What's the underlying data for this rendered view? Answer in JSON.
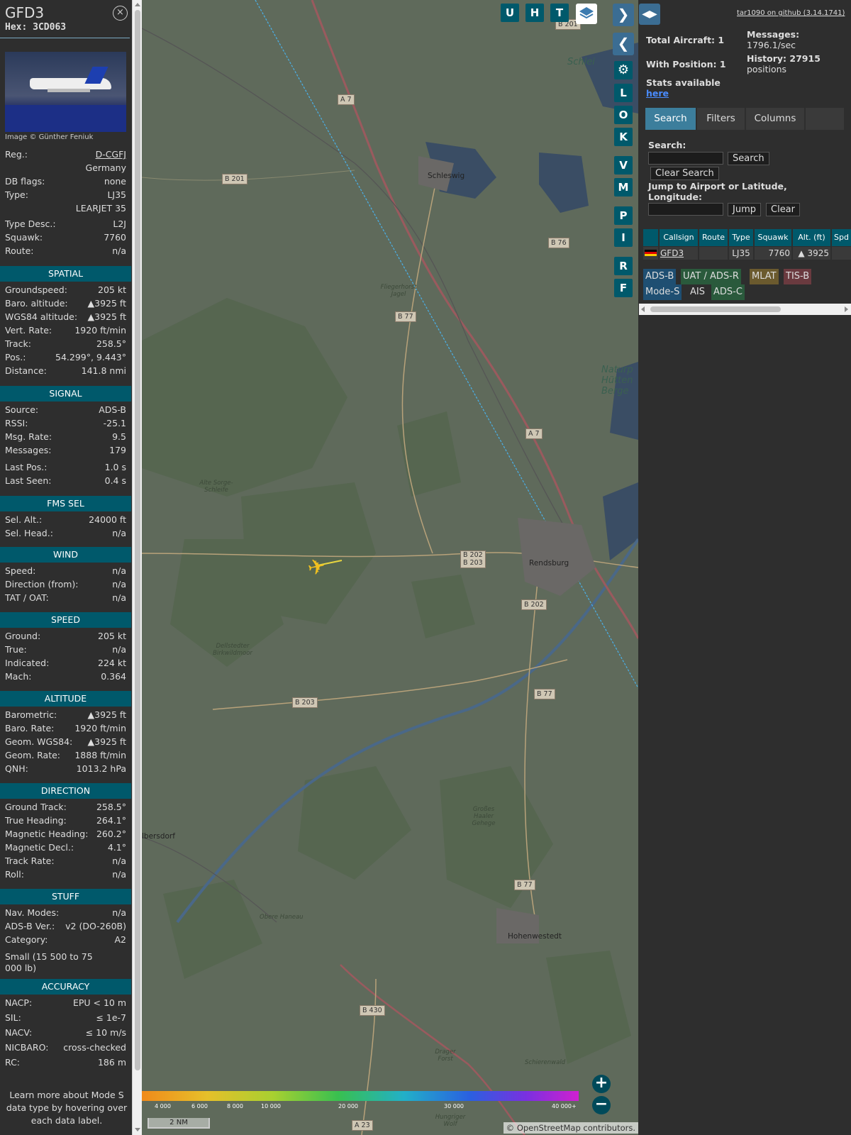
{
  "info": {
    "callsign": "GFD3",
    "hex": "Hex: 3CD063",
    "close_icon": "×",
    "image_credit": "Image © Günther Feniuk",
    "reg_label": "Reg.:",
    "reg_value": "D-CGFJ",
    "country": "Germany",
    "dbflags_label": "DB flags:",
    "dbflags_value": "none",
    "type_label": "Type:",
    "type_value": "LJ35",
    "type_name": "LEARJET 35",
    "typedesc_label": "Type Desc.:",
    "typedesc_value": "L2J",
    "squawk_label": "Squawk:",
    "squawk_value": "7760",
    "route_label": "Route:",
    "route_value": "n/a",
    "sections": {
      "spatial": "SPATIAL",
      "signal": "SIGNAL",
      "fms": "FMS SEL",
      "wind": "WIND",
      "speed": "SPEED",
      "altitude": "ALTITUDE",
      "direction": "DIRECTION",
      "stuff": "STUFF",
      "accuracy": "ACCURACY"
    },
    "spatial": [
      {
        "k": "Groundspeed:",
        "v": "205 kt"
      },
      {
        "k": "Baro. altitude:",
        "v": "▲3925 ft"
      },
      {
        "k": "WGS84 altitude:",
        "v": "▲3925 ft"
      },
      {
        "k": "Vert. Rate:",
        "v": "1920 ft/min"
      },
      {
        "k": "Track:",
        "v": "258.5°"
      },
      {
        "k": "Pos.:",
        "v": "54.299°, 9.443°"
      },
      {
        "k": "Distance:",
        "v": "141.8 nmi"
      }
    ],
    "signal": [
      {
        "k": "Source:",
        "v": "ADS-B"
      },
      {
        "k": "RSSI:",
        "v": "-25.1"
      },
      {
        "k": "Msg. Rate:",
        "v": "9.5"
      },
      {
        "k": "Messages:",
        "v": "179"
      },
      {
        "k": "Last Pos.:",
        "v": "1.0 s"
      },
      {
        "k": "Last Seen:",
        "v": "0.4 s"
      }
    ],
    "fms": [
      {
        "k": "Sel. Alt.:",
        "v": "24000 ft"
      },
      {
        "k": "Sel. Head.:",
        "v": "n/a"
      }
    ],
    "wind": [
      {
        "k": "Speed:",
        "v": "n/a"
      },
      {
        "k": "Direction (from):",
        "v": "n/a"
      },
      {
        "k": "TAT / OAT:",
        "v": "n/a"
      }
    ],
    "speed": [
      {
        "k": "Ground:",
        "v": "205 kt"
      },
      {
        "k": "True:",
        "v": "n/a"
      },
      {
        "k": "Indicated:",
        "v": "224 kt"
      },
      {
        "k": "Mach:",
        "v": "0.364"
      }
    ],
    "altitude": [
      {
        "k": "Barometric:",
        "v": "▲3925 ft"
      },
      {
        "k": "Baro. Rate:",
        "v": "1920 ft/min"
      },
      {
        "k": "Geom. WGS84:",
        "v": "▲3925 ft"
      },
      {
        "k": "Geom. Rate:",
        "v": "1888 ft/min"
      },
      {
        "k": "QNH:",
        "v": "1013.2 hPa"
      }
    ],
    "direction": [
      {
        "k": "Ground Track:",
        "v": "258.5°"
      },
      {
        "k": "True Heading:",
        "v": "264.1°"
      },
      {
        "k": "Magnetic Heading:",
        "v": "260.2°"
      },
      {
        "k": "Magnetic Decl.:",
        "v": "4.1°"
      },
      {
        "k": "Track Rate:",
        "v": "n/a"
      },
      {
        "k": "Roll:",
        "v": "n/a"
      }
    ],
    "stuff": [
      {
        "k": "Nav. Modes:",
        "v": "n/a"
      },
      {
        "k": "ADS-B Ver.:",
        "v": "v2 (DO-260B)"
      },
      {
        "k": "Category:",
        "v": "A2"
      }
    ],
    "category_desc": "Small (15 500 to 75 000 lb)",
    "accuracy": [
      {
        "k": "NACP:",
        "v": "EPU < 10 m"
      },
      {
        "k": "SIL:",
        "v": "≤ 1e-7"
      },
      {
        "k": "NACV:",
        "v": "≤ 10 m/s"
      },
      {
        "k": "NICBARO:",
        "v": "cross-checked"
      },
      {
        "k": "RC:",
        "v": "186 m"
      }
    ],
    "learn_more": "Learn more about Mode S data type by hovering over each data label."
  },
  "map": {
    "buttons_top": [
      "U",
      "H",
      "T"
    ],
    "buttons_side": [
      "L",
      "O",
      "K",
      "V",
      "M",
      "P",
      "I",
      "R",
      "F"
    ],
    "layers_icon": "layers-icon",
    "settings_icon": "gear-icon",
    "places": [
      {
        "name": "Schleswig"
      },
      {
        "name": "Rendsburg"
      },
      {
        "name": "Hohenwestedt"
      },
      {
        "name": "Schlei"
      },
      {
        "name": "Fliegerhorst Jagel"
      },
      {
        "name": "Alte Sorge-Schleife"
      },
      {
        "name": "Dellstedter Birkwildmoor"
      },
      {
        "name": "Obere Haneau"
      },
      {
        "name": "Großes Haaler Gehege"
      },
      {
        "name": "Schierenwald"
      },
      {
        "name": "Naturp Hütten Berge"
      },
      {
        "name": "Drager Forst"
      },
      {
        "name": "Hungriger Wolf"
      },
      {
        "name": "lbersdorf"
      }
    ],
    "roads": [
      "B 201",
      "A 7",
      "B 201",
      "B 76",
      "B 77",
      "A 7",
      "B 202",
      "B 203",
      "B 202",
      "B 203",
      "B 77",
      "B 77",
      "B 430",
      "A 23"
    ],
    "altitude_scale": [
      "4 000",
      "6 000",
      "8 000",
      "10 000",
      "20 000",
      "30 000",
      "40 000+"
    ],
    "scale_label": "2 NM",
    "attribution_prefix": "© ",
    "attribution_link": "OpenStreetMap",
    "attribution_suffix": " contributors."
  },
  "panel": {
    "github_link": "tar1090 on github (3.14.1741)",
    "total_aircraft": "Total Aircraft: 1",
    "with_position": "With Position: 1",
    "messages_label": "Messages:",
    "messages_value": "1796.1/sec",
    "history_label": "History: 27915",
    "history_value": "positions",
    "stats_text": "Stats available",
    "stats_link": "here",
    "tabs": [
      "Search",
      "Filters",
      "Columns"
    ],
    "search_label": "Search:",
    "search_button": "Search",
    "clear_search_button": "Clear Search",
    "jump_label": "Jump to Airport or Latitude, Longitude:",
    "jump_button": "Jump",
    "clear_button": "Clear",
    "table_headers": [
      "Callsign",
      "Route",
      "Type",
      "Squawk",
      "Alt. (ft)",
      "Spd"
    ],
    "table_row": {
      "flag": "flag-de-icon",
      "callsign": "GFD3",
      "route": "",
      "type": "LJ35",
      "squawk": "7760",
      "alt": "▲ 3925"
    },
    "legend": [
      {
        "label": "ADS-B",
        "color": "#1f4f72"
      },
      {
        "label": "UAT / ADS-R",
        "color": "#2a5a3c"
      },
      {
        "label": "MLAT",
        "color": "#6b5a2e"
      },
      {
        "label": "TIS-B",
        "color": "#6a3a3f"
      },
      {
        "label": "Mode-S",
        "color": "#1f4f72"
      },
      {
        "label": "AIS",
        "color": "#2e2e2e"
      },
      {
        "label": "ADS-C",
        "color": "#2a5a3c"
      }
    ]
  }
}
